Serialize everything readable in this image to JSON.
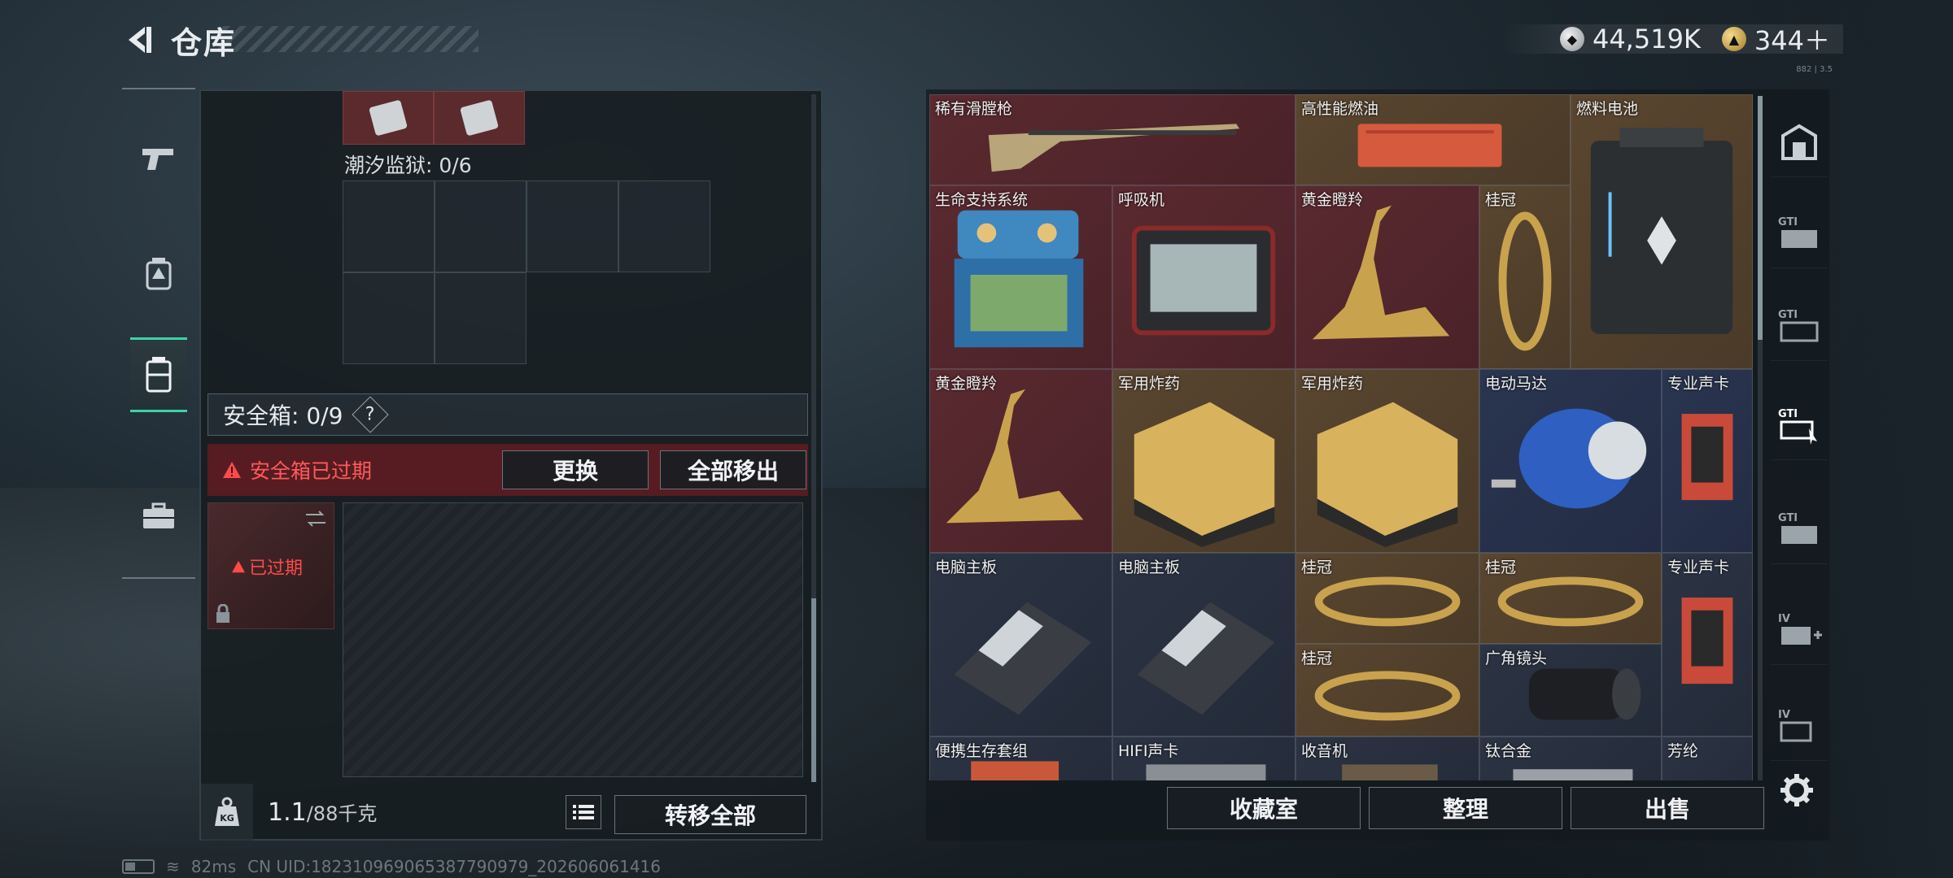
{
  "header": {
    "title": "仓库"
  },
  "currency": {
    "silver": "44,519K",
    "gold": "344＋",
    "version": "882 | 3.5"
  },
  "left_panel": {
    "prison_label": "潮汐监狱: 0/6",
    "safe_box_label": "安全箱: 0/9",
    "safe_expired_text": "安全箱已过期",
    "replace_button": "更换",
    "remove_all_button": "全部移出",
    "safe_item_status": "已过期",
    "weight_value": "1.1",
    "weight_capacity": "/88千克",
    "transfer_all_button": "转移全部"
  },
  "inventory": {
    "items": [
      {
        "name": "稀有滑膛枪",
        "rarity": "red"
      },
      {
        "name": "高性能燃油",
        "rarity": "gold"
      },
      {
        "name": "燃料电池",
        "rarity": "gold"
      },
      {
        "name": "生命支持系统",
        "rarity": "red"
      },
      {
        "name": "呼吸机",
        "rarity": "red"
      },
      {
        "name": "黄金瞪羚",
        "rarity": "red"
      },
      {
        "name": "桂冠",
        "rarity": "gold"
      },
      {
        "name": "黄金瞪羚",
        "rarity": "red"
      },
      {
        "name": "军用炸药",
        "rarity": "gold"
      },
      {
        "name": "军用炸药",
        "rarity": "gold"
      },
      {
        "name": "电动马达",
        "rarity": "blue"
      },
      {
        "name": "专业声卡",
        "rarity": "blue"
      },
      {
        "name": "电脑主板",
        "rarity": "navy"
      },
      {
        "name": "电脑主板",
        "rarity": "navy"
      },
      {
        "name": "桂冠",
        "rarity": "gold"
      },
      {
        "name": "桂冠",
        "rarity": "gold"
      },
      {
        "name": "专业声卡",
        "rarity": "navy"
      },
      {
        "name": "桂冠",
        "rarity": "gold"
      },
      {
        "name": "广角镜头",
        "rarity": "navy"
      },
      {
        "name": "便携生存套组",
        "rarity": "navy"
      },
      {
        "name": "HIFI声卡",
        "rarity": "navy"
      },
      {
        "name": "收音机",
        "rarity": "navy"
      },
      {
        "name": "钛合金",
        "rarity": "navy"
      },
      {
        "name": "芳纶",
        "rarity": "navy"
      }
    ]
  },
  "bottom_buttons": {
    "collection": "收藏室",
    "organize": "整理",
    "sell": "出售"
  },
  "right_rail": [
    "GTI",
    "GTI",
    "GTI",
    "GTI",
    "IV",
    "IV"
  ],
  "footer": {
    "ping": "82ms",
    "uid": "CN UID:18231096906538779097​9_202606061416"
  }
}
